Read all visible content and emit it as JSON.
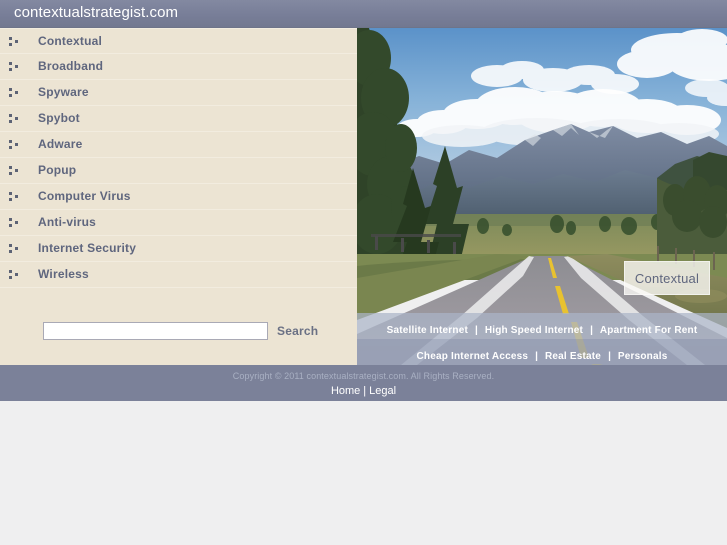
{
  "header": {
    "site_title": "contextualstrategist.com",
    "bg_color": "#787e98",
    "text_color": "#ffffff"
  },
  "sidebar": {
    "bg_color": "#ece4d3",
    "link_color": "#5f667e",
    "bullet_icon": "three-dot-bullet-icon",
    "items": [
      {
        "label": "Contextual"
      },
      {
        "label": "Broadband"
      },
      {
        "label": "Spyware"
      },
      {
        "label": "Spybot"
      },
      {
        "label": "Adware"
      },
      {
        "label": "Popup"
      },
      {
        "label": "Computer Virus"
      },
      {
        "label": "Anti-virus"
      },
      {
        "label": "Internet Security"
      },
      {
        "label": "Wireless"
      }
    ]
  },
  "search": {
    "value": "",
    "placeholder": "",
    "button_label": "Search"
  },
  "hero": {
    "image_alt": "mountain-road-landscape-photo",
    "overlay_label": "Contextual",
    "link_rows": [
      {
        "links": [
          "Satellite Internet",
          "High Speed Internet",
          "Apartment For Rent"
        ],
        "separator": "|"
      },
      {
        "links": [
          "Cheap Internet Access",
          "Real Estate",
          "Personals"
        ],
        "separator": "|"
      }
    ]
  },
  "footer": {
    "copyright": "Copyright © 2011 contextualstrategist.com. All Rights Reserved.",
    "links": [
      "Home",
      "Legal"
    ],
    "separator": "|",
    "bg_color": "#7b8199"
  }
}
